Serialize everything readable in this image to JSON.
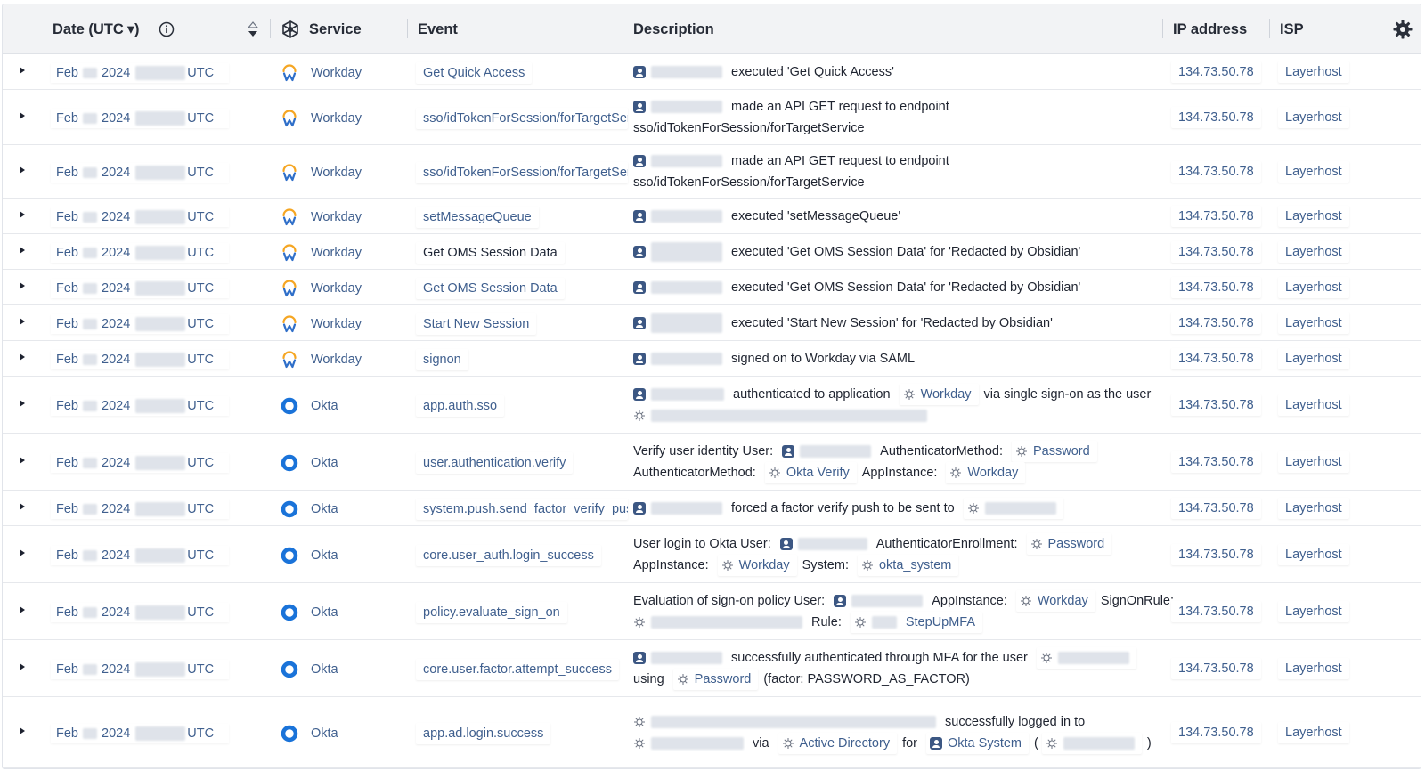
{
  "header": {
    "date_label": "Date (UTC",
    "date_caret": "▾)",
    "service_label": "Service",
    "event_label": "Event",
    "description_label": "Description",
    "ip_label": "IP address",
    "isp_label": "ISP"
  },
  "date_parts": {
    "month": "Feb",
    "year": "2024",
    "tz": "UTC"
  },
  "rows": [
    {
      "service": "Workday",
      "event": "Get Quick Access",
      "ip": "134.73.50.78",
      "isp": "Layerhost",
      "desc": {
        "l1": "executed 'Get Quick Access'"
      }
    },
    {
      "service": "Workday",
      "event": "sso/idTokenForSession/forTargetService",
      "ip": "134.73.50.78",
      "isp": "Layerhost",
      "desc": {
        "l1": "made an API GET request to endpoint",
        "l2": "sso/idTokenForSession/forTargetService"
      }
    },
    {
      "service": "Workday",
      "event": "sso/idTokenForSession/forTargetService",
      "ip": "134.73.50.78",
      "isp": "Layerhost",
      "desc": {
        "l1": "made an API GET request to endpoint",
        "l2": "sso/idTokenForSession/forTargetService"
      }
    },
    {
      "service": "Workday",
      "event": "setMessageQueue",
      "ip": "134.73.50.78",
      "isp": "Layerhost",
      "desc": {
        "l1": "executed 'setMessageQueue'"
      }
    },
    {
      "service": "Workday",
      "event": "Get OMS Session Data",
      "ip": "134.73.50.78",
      "isp": "Layerhost",
      "desc": {
        "l1": "executed 'Get OMS Session Data' for 'Redacted by Obsidian'"
      }
    },
    {
      "service": "Workday",
      "event": "Get OMS Session Data",
      "ip": "134.73.50.78",
      "isp": "Layerhost",
      "desc": {
        "l1": "executed 'Get OMS Session Data' for 'Redacted by Obsidian'"
      }
    },
    {
      "service": "Workday",
      "event": "Start New Session",
      "ip": "134.73.50.78",
      "isp": "Layerhost",
      "desc": {
        "l1": "executed 'Start New Session' for 'Redacted by Obsidian'"
      }
    },
    {
      "service": "Workday",
      "event": "signon",
      "ip": "134.73.50.78",
      "isp": "Layerhost",
      "desc": {
        "l1": "signed on to Workday via SAML"
      }
    },
    {
      "service": "Okta",
      "event": "app.auth.sso",
      "ip": "134.73.50.78",
      "isp": "Layerhost",
      "desc": {
        "a": "authenticated to application",
        "app": "Workday",
        "b": "via single sign-on as the user"
      }
    },
    {
      "service": "Okta",
      "event": "user.authentication.verify",
      "ip": "134.73.50.78",
      "isp": "Layerhost",
      "desc": {
        "a": "Verify user identity User:",
        "b": "AuthenticatorMethod:",
        "c": "Password",
        "d": "AuthenticatorMethod:",
        "e": "Okta Verify",
        "f": "AppInstance:",
        "g": "Workday"
      }
    },
    {
      "service": "Okta",
      "event": "system.push.send_factor_verify_push",
      "ip": "134.73.50.78",
      "isp": "Layerhost",
      "desc": {
        "a": "forced a factor verify push to be sent to"
      }
    },
    {
      "service": "Okta",
      "event": "core.user_auth.login_success",
      "ip": "134.73.50.78",
      "isp": "Layerhost",
      "desc": {
        "a": "User login to Okta User:",
        "b": "AuthenticatorEnrollment:",
        "c": "Password",
        "d": "AppInstance:",
        "e": "Workday",
        "f": "System:",
        "g": "okta_system"
      }
    },
    {
      "service": "Okta",
      "event": "policy.evaluate_sign_on",
      "ip": "134.73.50.78",
      "isp": "Layerhost",
      "desc": {
        "a": "Evaluation of sign-on policy User:",
        "b": "AppInstance:",
        "c": "Workday",
        "d": "SignOnRule:",
        "e": "Rule:",
        "f": "StepUpMFA"
      }
    },
    {
      "service": "Okta",
      "event": "core.user.factor.attempt_success",
      "ip": "134.73.50.78",
      "isp": "Layerhost",
      "desc": {
        "a": "successfully authenticated through MFA for the user",
        "b": "using",
        "c": "Password",
        "d": "(factor: PASSWORD_AS_FACTOR)"
      }
    },
    {
      "service": "Okta",
      "event": "app.ad.login.success",
      "ip": "134.73.50.78",
      "isp": "Layerhost",
      "desc": {
        "a": "successfully logged in to",
        "b": "via",
        "c": "Active Directory",
        "d": "for",
        "e": "Okta System",
        "f": "(",
        "g": ")"
      }
    }
  ],
  "colors": {
    "link": "#3f5f8e",
    "workday_orange": "#f5a623",
    "workday_blue": "#2f6fc9",
    "okta_blue": "#1a73d9",
    "user_icon": "#3c5783"
  },
  "icons": {
    "info": "info-icon",
    "sort": "sort-icon",
    "service": "service-icon",
    "settings": "gear-icon",
    "expand": "caret-right-icon",
    "user": "user-icon",
    "entity": "entity-icon"
  }
}
